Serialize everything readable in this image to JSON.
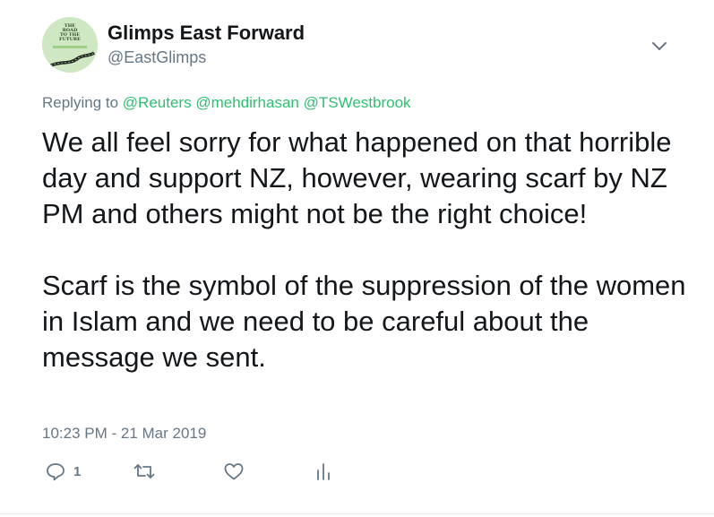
{
  "account": {
    "display_name": "Glimps East Forward",
    "handle": "@EastGlimps",
    "avatar_text": "THE ROAD TO THE FUTURE"
  },
  "reply": {
    "prefix": "Replying to",
    "mentions": [
      "@Reuters",
      "@mehdirhasan",
      "@TSWestbrook"
    ]
  },
  "tweet": {
    "paragraphs": [
      "We all feel sorry for what happened on that horrible day and support NZ, however, wearing scarf by NZ PM and others might not be the right choice!",
      "Scarf is the symbol of the suppression of the women in Islam and we need to be careful about the message we sent."
    ],
    "timestamp": "10:23 PM - 21 Mar 2019"
  },
  "actions": {
    "reply_count": "1",
    "retweet_count": "",
    "like_count": ""
  },
  "colors": {
    "text": "#14171a",
    "secondary": "#657786",
    "link": "#2fbf71",
    "icon": "#657786"
  },
  "icons": [
    "chevron-down-icon",
    "reply-icon",
    "retweet-icon",
    "like-icon",
    "analytics-icon"
  ]
}
